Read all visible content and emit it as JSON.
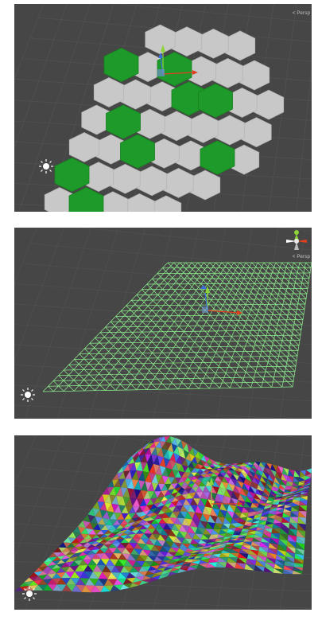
{
  "panels": [
    {
      "persp_label": "< Persp"
    },
    {
      "persp_label": "< Persp"
    },
    {
      "persp_label": ""
    }
  ],
  "colors": {
    "background": "#464646",
    "hex_grey": "#c8c8c8",
    "hex_green": "#1e9a2a",
    "wireframe": "#8ef08e",
    "axis_x": "#e0401d",
    "axis_y": "#8ed33a",
    "axis_z": "#3b6fe0"
  },
  "icons": {
    "light": "sun-icon",
    "orientation": "scene-gizmo-icon",
    "move_tool": "move-gizmo-icon"
  }
}
